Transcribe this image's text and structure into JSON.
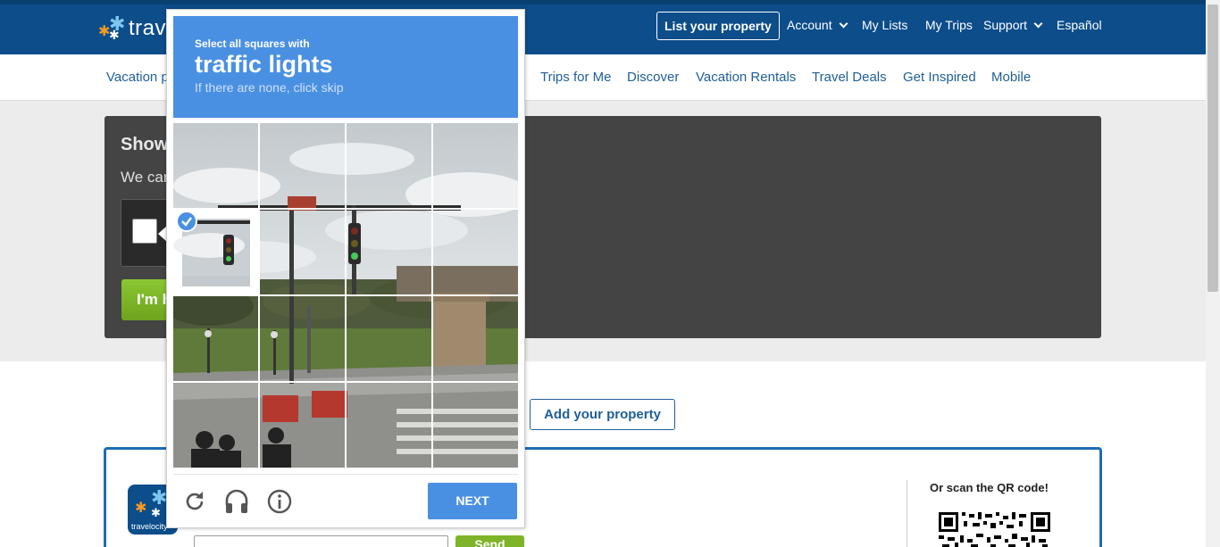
{
  "header": {
    "logo_text": "travelocity",
    "list_property": "List your property",
    "nav": [
      {
        "label": "Account",
        "has_menu": true
      },
      {
        "label": "My Lists",
        "has_menu": false
      },
      {
        "label": "My Trips",
        "has_menu": false
      },
      {
        "label": "Support",
        "has_menu": true
      },
      {
        "label": "Español",
        "has_menu": false
      }
    ]
  },
  "subnav": {
    "items": [
      "Vacation p",
      "Trips for Me",
      "Discover",
      "Vacation Rentals",
      "Travel Deals",
      "Get Inspired",
      "Mobile"
    ]
  },
  "verify_panel": {
    "title": "Show",
    "subtitle": "We car",
    "button_label": "I'm h"
  },
  "add_property": "Add your property",
  "app_promo": {
    "icon_label": "travelocity",
    "qr_label": "Or scan the QR code!",
    "send_label": "Send"
  },
  "captcha": {
    "line1": "Select all squares with",
    "target": "traffic lights",
    "line3": "If there are none, click skip",
    "next_label": "NEXT",
    "selected_tiles": [
      4
    ],
    "icons": [
      "reload-icon",
      "audio-icon",
      "info-icon"
    ]
  },
  "colors": {
    "brand_blue": "#0c4d8a",
    "captcha_blue": "#4a90e2",
    "link_blue": "#1f5f99",
    "green": "#7db428"
  }
}
